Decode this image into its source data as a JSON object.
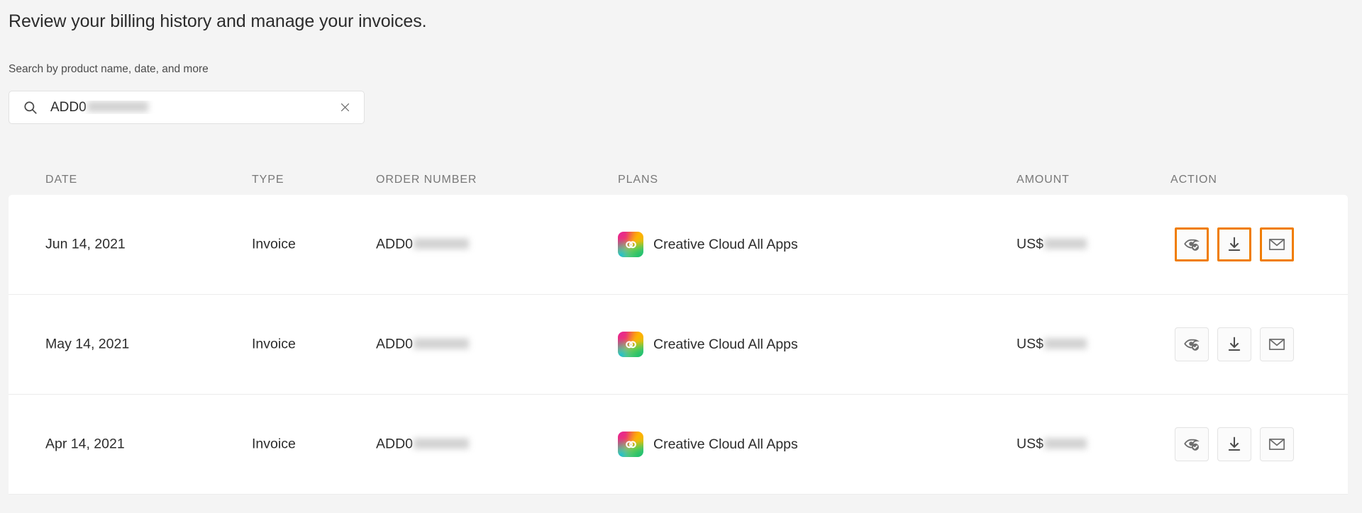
{
  "page": {
    "heading": "Review your billing history and manage your invoices.",
    "background_color": "#f4f4f4",
    "focus_color": "#f07d00"
  },
  "search": {
    "label": "Search by product name, date, and more",
    "value": "ADD0",
    "value_redacted": true,
    "placeholder": "Search by product name, date, and more",
    "search_icon": "search-icon",
    "clear_icon": "close-icon"
  },
  "table": {
    "columns": [
      {
        "key": "date",
        "label": "DATE"
      },
      {
        "key": "type",
        "label": "TYPE"
      },
      {
        "key": "order",
        "label": "ORDER NUMBER"
      },
      {
        "key": "plans",
        "label": "PLANS"
      },
      {
        "key": "amount",
        "label": "AMOUNT"
      },
      {
        "key": "action",
        "label": "ACTION"
      }
    ],
    "rows": [
      {
        "date": "Jun 14, 2021",
        "type": "Invoice",
        "order": "ADD0",
        "plan": "Creative Cloud All Apps",
        "plan_icon": "creative-cloud-icon",
        "amount": "US$",
        "actions_focused": true
      },
      {
        "date": "May 14, 2021",
        "type": "Invoice",
        "order": "ADD0",
        "plan": "Creative Cloud All Apps",
        "plan_icon": "creative-cloud-icon",
        "amount": "US$",
        "actions_focused": false
      },
      {
        "date": "Apr 14, 2021",
        "type": "Invoice",
        "order": "ADD0",
        "plan": "Creative Cloud All Apps",
        "plan_icon": "creative-cloud-icon",
        "amount": "US$",
        "actions_focused": false
      }
    ],
    "row_actions": [
      {
        "key": "view",
        "icon": "view-invoice-icon"
      },
      {
        "key": "download",
        "icon": "download-icon"
      },
      {
        "key": "email",
        "icon": "email-icon"
      }
    ]
  }
}
